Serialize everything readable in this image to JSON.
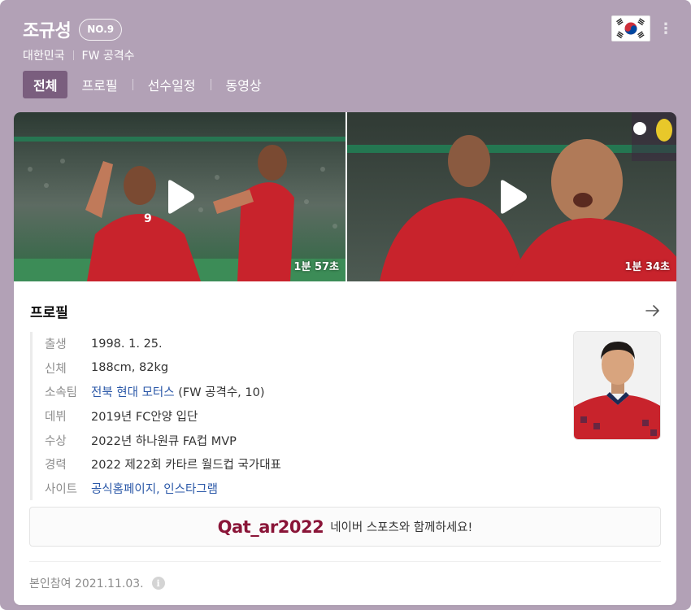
{
  "player": {
    "name": "조규성",
    "number": "NO.9",
    "country": "대한민국",
    "position": "FW 공격수"
  },
  "icons": {
    "flag": "korea-flag-icon",
    "more": "more-vertical-icon",
    "play": "play-icon",
    "arrow": "arrow-right-icon",
    "info": "info-icon"
  },
  "tabs": [
    {
      "label": "전체",
      "active": true
    },
    {
      "label": "프로필",
      "active": false
    },
    {
      "label": "선수일정",
      "active": false
    },
    {
      "label": "동영상",
      "active": false
    }
  ],
  "videos": [
    {
      "duration": "1분 57초"
    },
    {
      "duration": "1분 34초"
    }
  ],
  "profile": {
    "title": "프로필",
    "rows": [
      {
        "label": "출생",
        "value": "1998. 1. 25."
      },
      {
        "label": "신체",
        "value": "188cm, 82kg"
      },
      {
        "label": "소속팀",
        "link": "전북 현대 모터스",
        "value": " (FW 공격수, 10)"
      },
      {
        "label": "데뷔",
        "value": "2019년 FC안양 입단"
      },
      {
        "label": "수상",
        "value": "2022년 하나원큐 FA컵 MVP"
      },
      {
        "label": "경력",
        "value": "2022 제22회 카타르 월드컵 국가대표"
      },
      {
        "label": "사이트",
        "link": "공식홈페이지, 인스타그램",
        "value": ""
      }
    ]
  },
  "banner": {
    "logo": "Qat_ar2022",
    "text": "네이버 스포츠와 함께하세요!"
  },
  "footer": {
    "text": "본인참여 2021.11.03."
  },
  "colors": {
    "header_bg": "#b2a1b6",
    "active_tab": "#7a5e7e",
    "link": "#2b58a8",
    "qatar": "#8a1538",
    "kit_red": "#c8232c"
  }
}
